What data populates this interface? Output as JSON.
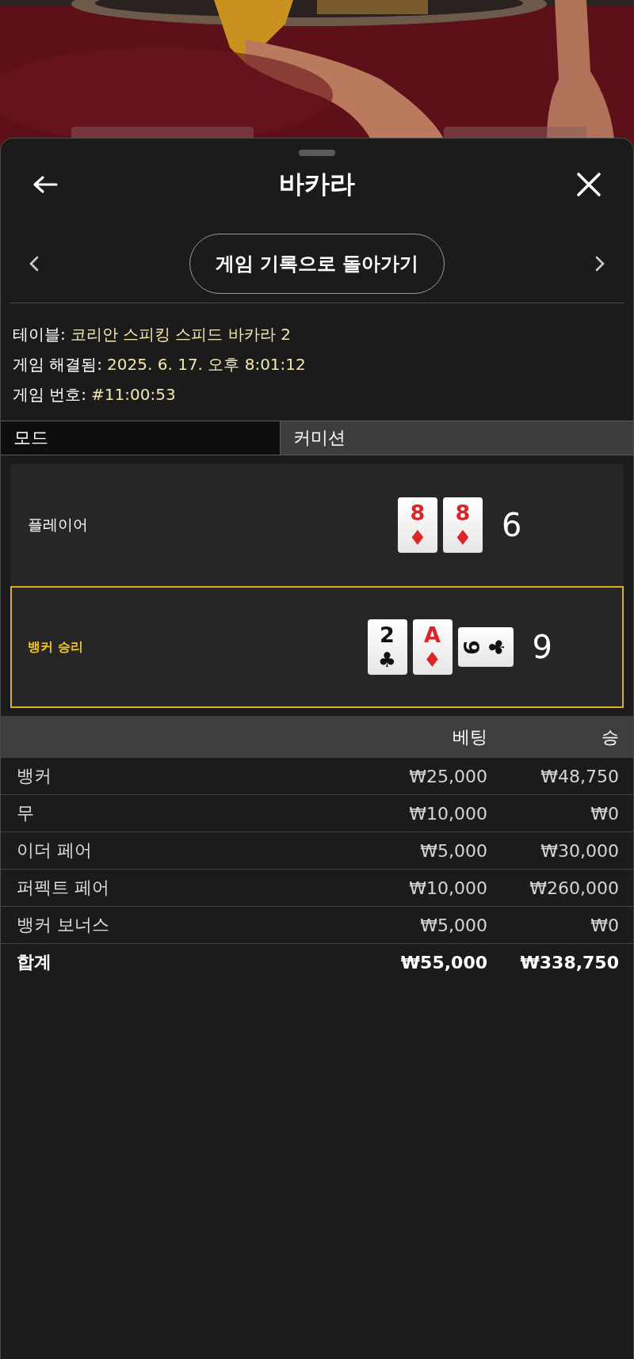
{
  "header": {
    "title": "바카라"
  },
  "back_button": "게임 기록으로 돌아가기",
  "info": [
    {
      "label": "테이블:",
      "value": "코리안 스피킹 스피드 바카라 2"
    },
    {
      "label": "게임 해결됨:",
      "value": "2025. 6. 17. 오후 8:01:12"
    },
    {
      "label": "게임 번호:",
      "value": "#11:00:53"
    }
  ],
  "mode": {
    "label": "모드",
    "value": "커미션"
  },
  "hands": [
    {
      "label": "플레이어",
      "winner": false,
      "score": "6",
      "cards": [
        {
          "rank": "8",
          "suit": "♦",
          "color": "#d8262a",
          "rotated": false
        },
        {
          "rank": "8",
          "suit": "♦",
          "color": "#d8262a",
          "rotated": false
        }
      ]
    },
    {
      "label": "뱅커 승리",
      "winner": true,
      "score": "9",
      "cards": [
        {
          "rank": "2",
          "suit": "♣",
          "color": "#111111",
          "rotated": false
        },
        {
          "rank": "A",
          "suit": "♦",
          "color": "#d8262a",
          "rotated": false
        },
        {
          "rank": "6",
          "suit": "♣",
          "color": "#111111",
          "rotated": true
        }
      ]
    }
  ],
  "bets": {
    "columns": [
      "베팅",
      "승"
    ],
    "rows": [
      {
        "name": "뱅커",
        "bet": "₩25,000",
        "win": "₩48,750"
      },
      {
        "name": "무",
        "bet": "₩10,000",
        "win": "₩0"
      },
      {
        "name": "이더 페어",
        "bet": "₩5,000",
        "win": "₩30,000"
      },
      {
        "name": "퍼펙트 페어",
        "bet": "₩10,000",
        "win": "₩260,000"
      },
      {
        "name": "뱅커 보너스",
        "bet": "₩5,000",
        "win": "₩0"
      }
    ],
    "total": {
      "name": "합계",
      "bet": "₩55,000",
      "win": "₩338,750"
    }
  }
}
